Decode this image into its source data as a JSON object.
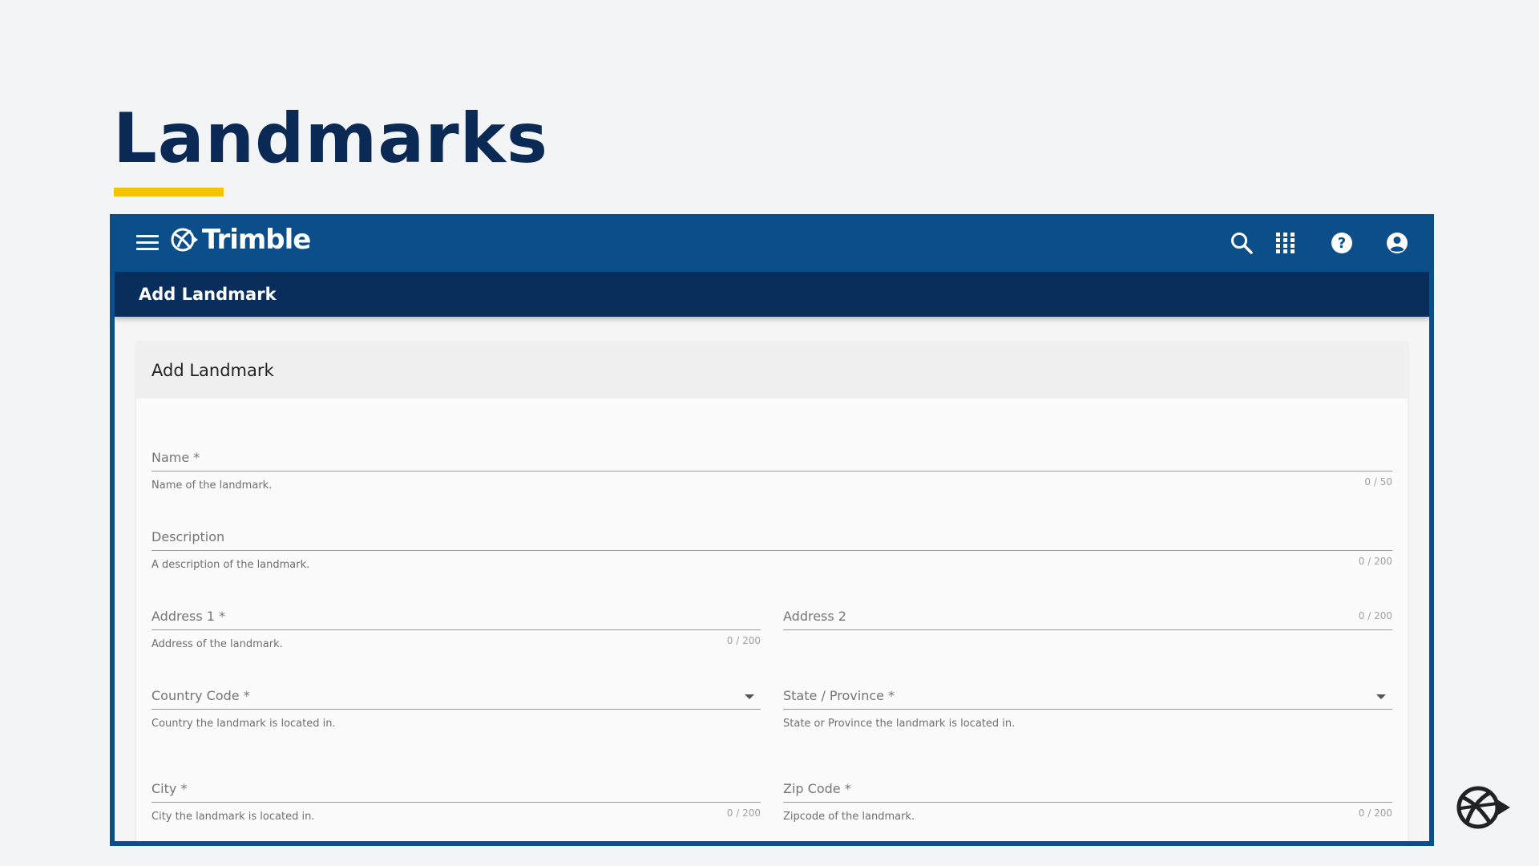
{
  "slide": {
    "title": "Landmarks"
  },
  "appbar": {
    "brand": "Trimble",
    "icons": [
      "menu-icon",
      "trimble-logo-icon",
      "search-icon",
      "apps-grid-icon",
      "help-icon",
      "account-icon"
    ]
  },
  "subbar": {
    "title": "Add Landmark"
  },
  "card": {
    "title": "Add Landmark",
    "fields": {
      "name": {
        "label": "Name *",
        "hint": "Name of the landmark.",
        "counter": "0 / 50"
      },
      "description": {
        "label": "Description",
        "hint": "A description of the landmark.",
        "counter": "0 / 200"
      },
      "address1": {
        "label": "Address 1 *",
        "hint": "Address of the landmark.",
        "counter": "0 / 200"
      },
      "address2": {
        "label": "Address 2",
        "counter": "0 / 200"
      },
      "country": {
        "label": "Country Code *",
        "hint": "Country the landmark is located in."
      },
      "state": {
        "label": "State / Province *",
        "hint": "State or Province the landmark is located in."
      },
      "city": {
        "label": "City *",
        "hint": "City the landmark is located in.",
        "counter": "0 / 200"
      },
      "zip": {
        "label": "Zip Code *",
        "hint": "Zipcode of the landmark.",
        "counter": "0 / 200"
      }
    }
  },
  "colors": {
    "navy": "#0a2a55",
    "appbar": "#0b4e8a",
    "subbar": "#0a2e5c",
    "accent": "#f5c400"
  }
}
